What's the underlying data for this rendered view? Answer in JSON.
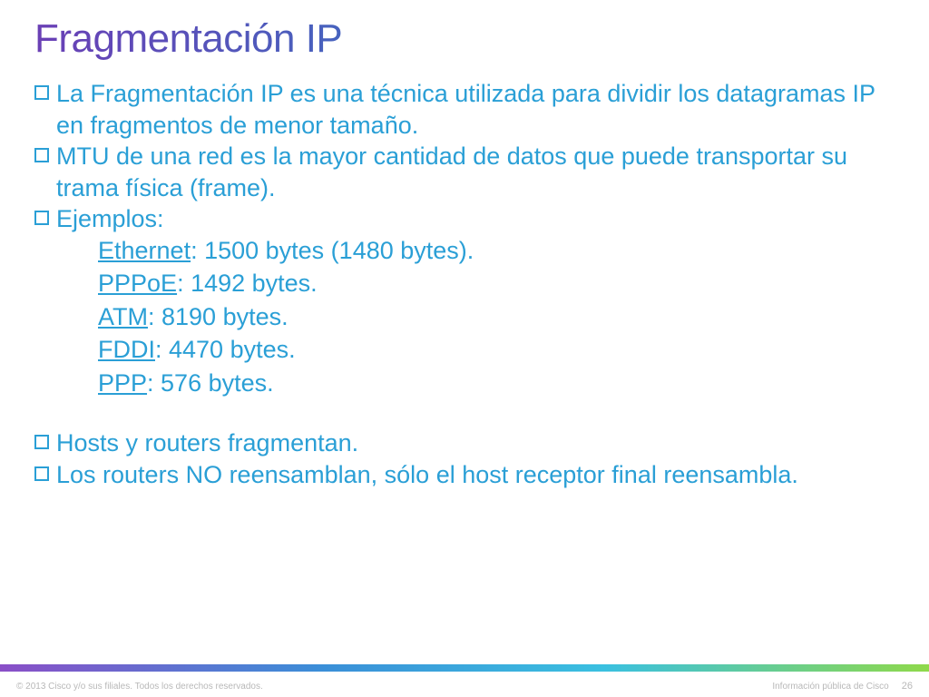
{
  "title": "Fragmentación IP",
  "bullets": {
    "b1": "La Fragmentación IP es una técnica utilizada para dividir los datagramas IP en fragmentos de menor tamaño.",
    "b2": "MTU de una red es la mayor cantidad de datos que puede transportar su trama física (frame).",
    "b3": "Ejemplos:",
    "examples": {
      "e1_name": "Ethernet",
      "e1_val": ": 1500 bytes (1480 bytes).",
      "e2_name": "PPPoE",
      "e2_val": ": 1492 bytes.",
      "e3_name": "ATM",
      "e3_val": ": 8190 bytes.",
      "e4_name": "FDDI",
      "e4_val": ": 4470 bytes.",
      "e5_name": "PPP",
      "e5_val": ": 576 bytes."
    },
    "b4": "Hosts y routers fragmentan.",
    "b5": "Los routers NO reensamblan, sólo el host receptor final reensambla."
  },
  "footer": {
    "copyright": "© 2013 Cisco y/o sus filiales. Todos los derechos reservados.",
    "classification": "Información pública de Cisco",
    "page": "26"
  }
}
